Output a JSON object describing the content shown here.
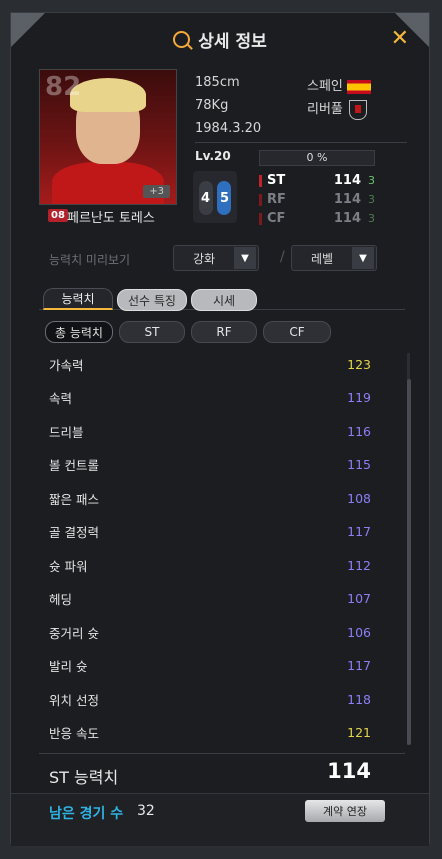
{
  "title": "상세 정보",
  "player": {
    "ovr": "82",
    "season_badge": "08",
    "name": "페르난도 토레스",
    "height": "185cm",
    "weight": "78Kg",
    "birth": "1984.3.20",
    "nation": "스페인",
    "club": "리버풀",
    "plus": "+3"
  },
  "level": {
    "label": "Lv.20",
    "exp": "0 %",
    "exp_fraction": 0
  },
  "foot": {
    "left": "4",
    "right": "5"
  },
  "positions": [
    {
      "name": "ST",
      "value": "114",
      "plus": "3"
    },
    {
      "name": "RF",
      "value": "114",
      "plus": "3"
    },
    {
      "name": "CF",
      "value": "114",
      "plus": "3"
    }
  ],
  "preview": {
    "label": "능력치 미리보기",
    "enhance": "강화",
    "level": "레벨",
    "separator": "/"
  },
  "tabs": [
    "능력치",
    "선수 특징",
    "시세"
  ],
  "filters": [
    "총 능력치",
    "ST",
    "RF",
    "CF"
  ],
  "stats": [
    {
      "name": "가속력",
      "value": "123",
      "color": "#e3d44a"
    },
    {
      "name": "속력",
      "value": "119",
      "color": "#8b7ff5"
    },
    {
      "name": "드리블",
      "value": "116",
      "color": "#8b7ff5"
    },
    {
      "name": "볼 컨트롤",
      "value": "115",
      "color": "#8b7ff5"
    },
    {
      "name": "짧은 패스",
      "value": "108",
      "color": "#8b7ff5"
    },
    {
      "name": "골 결정력",
      "value": "117",
      "color": "#8b7ff5"
    },
    {
      "name": "슛 파워",
      "value": "112",
      "color": "#8b7ff5"
    },
    {
      "name": "헤딩",
      "value": "107",
      "color": "#8b7ff5"
    },
    {
      "name": "중거리 슛",
      "value": "106",
      "color": "#8b7ff5"
    },
    {
      "name": "발리 슛",
      "value": "117",
      "color": "#8b7ff5"
    },
    {
      "name": "위치 선정",
      "value": "118",
      "color": "#8b7ff5"
    },
    {
      "name": "반응 속도",
      "value": "121",
      "color": "#e3d44a"
    }
  ],
  "total": {
    "label": "ST 능력치",
    "value": "114"
  },
  "footer": {
    "games_label": "남은 경기 수",
    "games_value": "32",
    "extend_button": "계약 연장"
  }
}
